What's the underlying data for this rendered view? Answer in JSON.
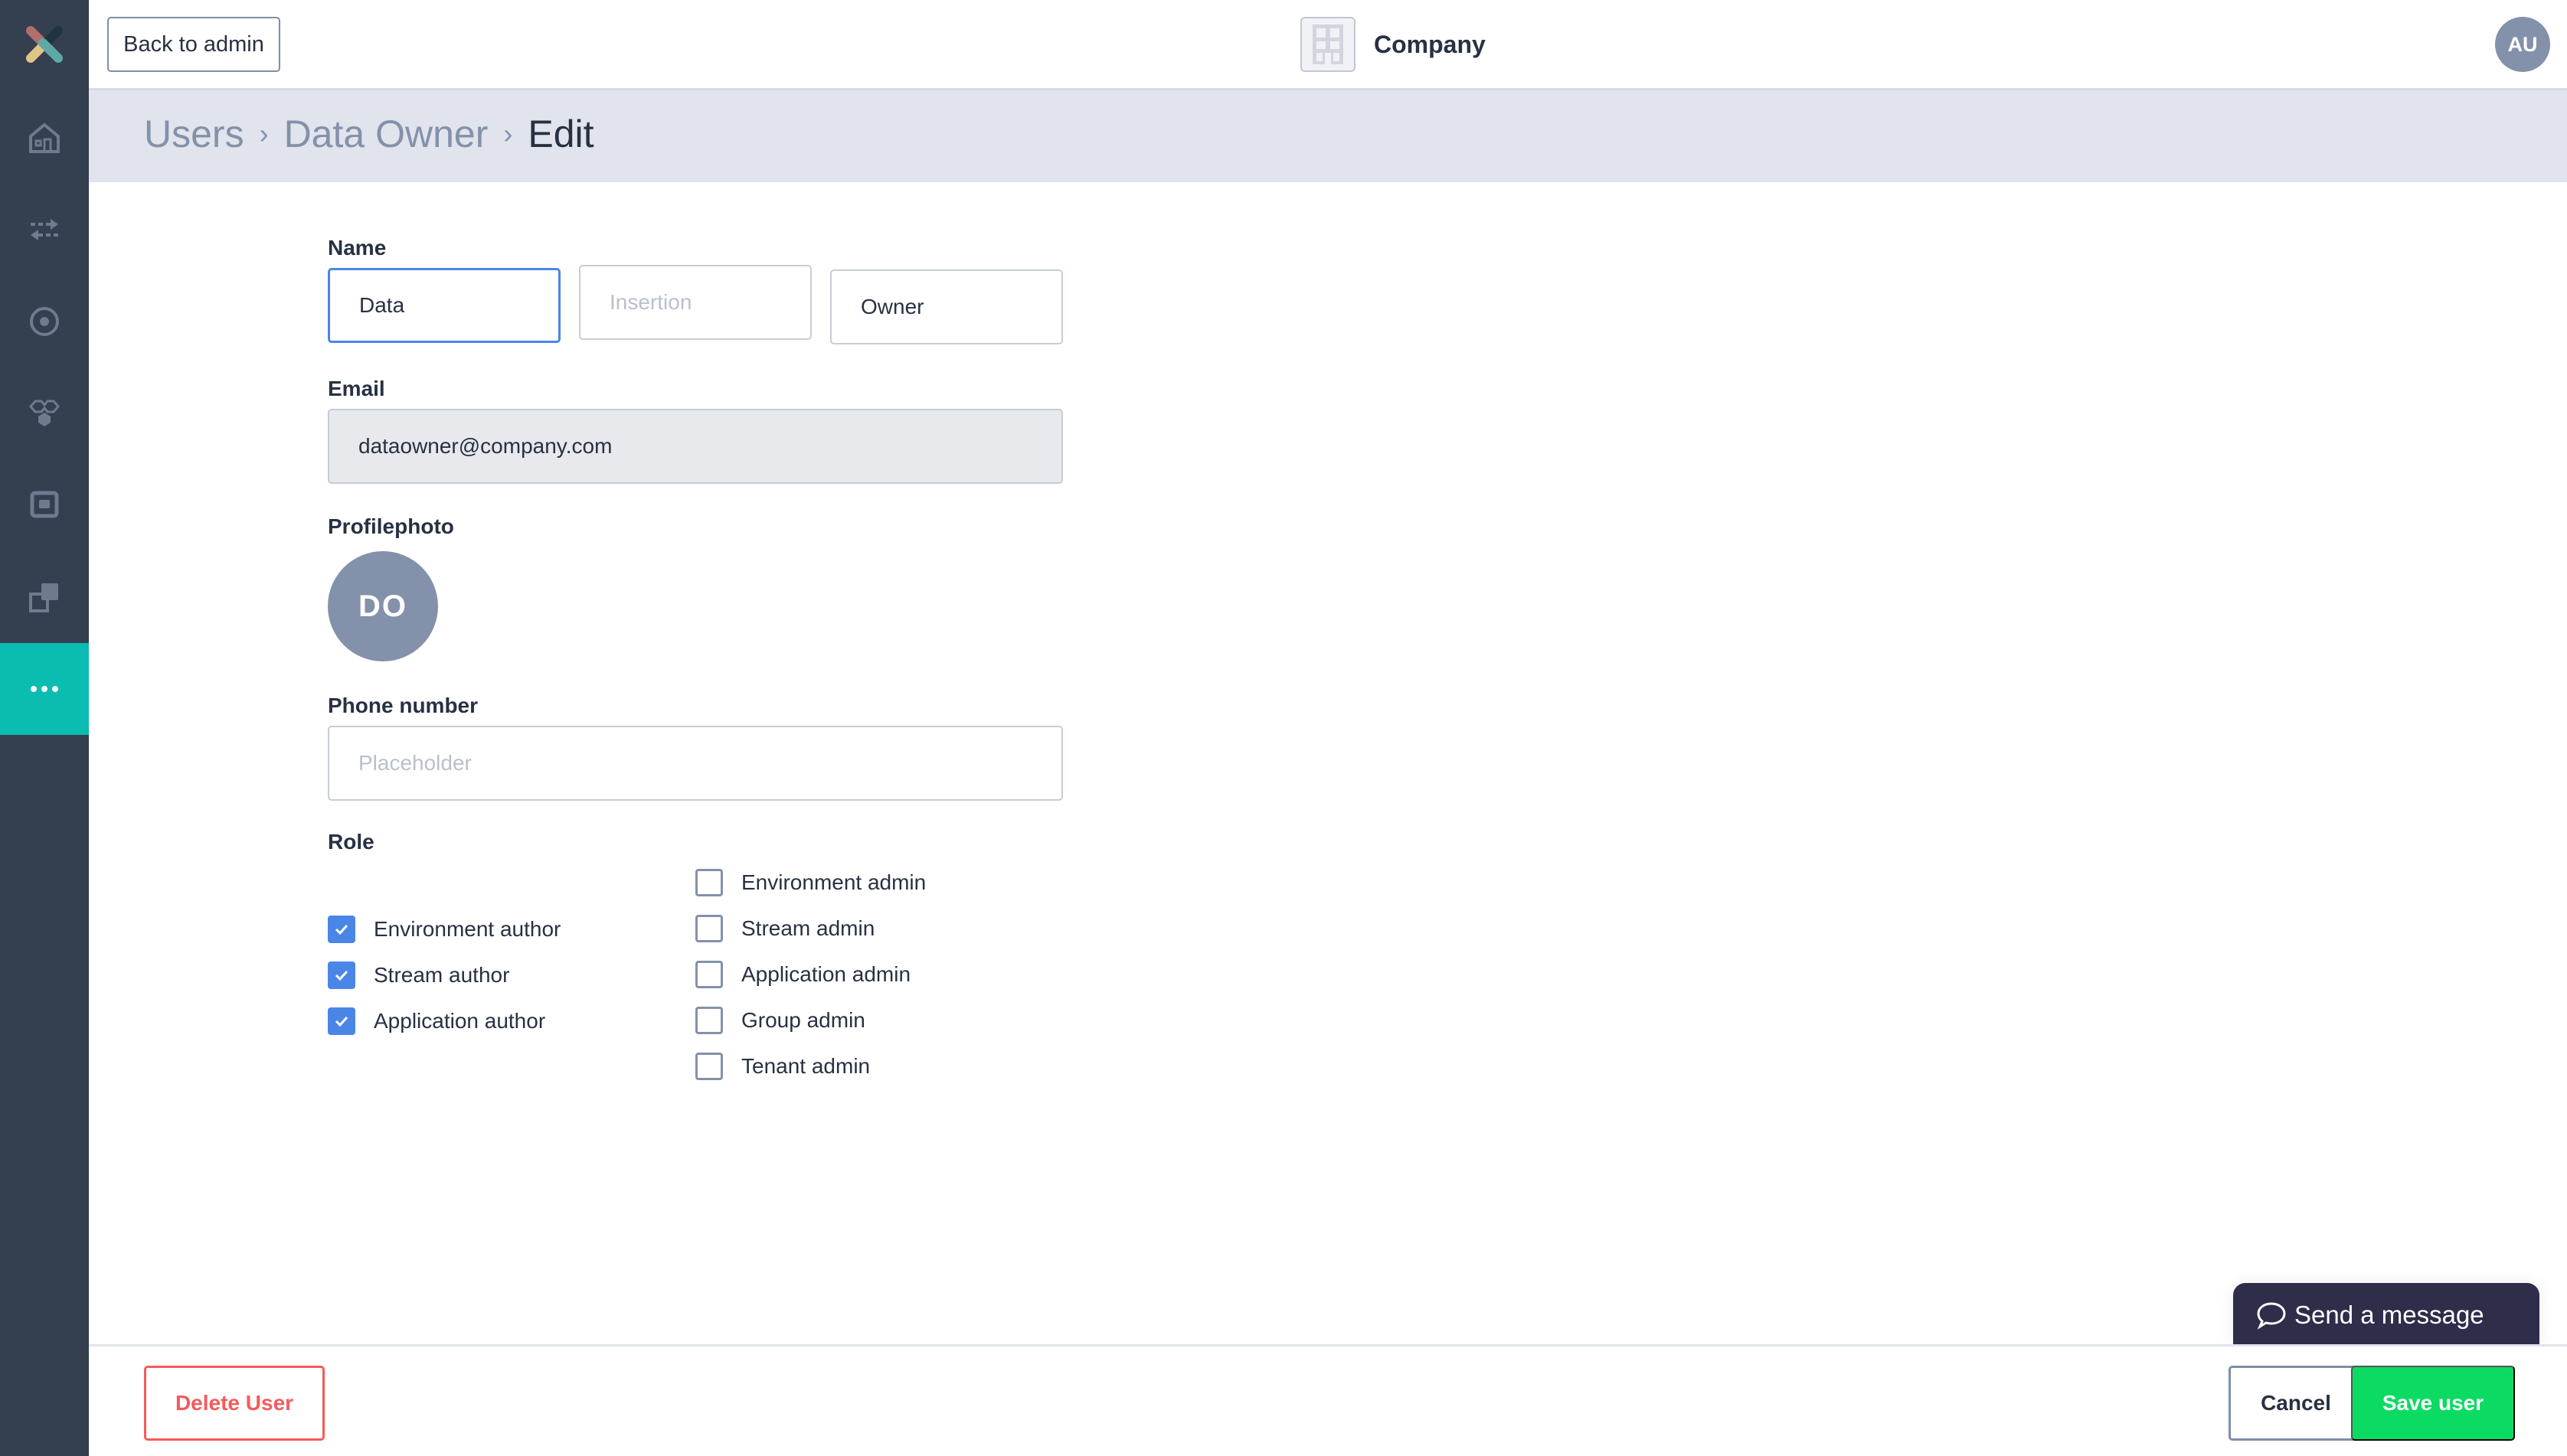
{
  "topbar": {
    "back_label": "Back to admin",
    "company_name": "Company",
    "user_initials": "AU"
  },
  "sidebar": {
    "items": [
      {
        "icon": "home-icon"
      },
      {
        "icon": "transfer-arrows-icon"
      },
      {
        "icon": "target-icon"
      },
      {
        "icon": "hexagon-group-icon"
      },
      {
        "icon": "square-frame-icon"
      },
      {
        "icon": "overlapping-squares-icon"
      },
      {
        "icon": "more-dots-icon",
        "active": true
      }
    ],
    "active_color": "#0bbcb0"
  },
  "breadcrumb": {
    "items": [
      "Users",
      "Data Owner",
      "Edit"
    ],
    "separator": "›"
  },
  "form": {
    "name_label": "Name",
    "first_name": "Data",
    "middle_name_placeholder": "Insertion",
    "last_name": "Owner",
    "email_label": "Email",
    "email_value": "dataowner@company.com",
    "photo_label": "Profilephoto",
    "photo_initials": "DO",
    "phone_label": "Phone number",
    "phone_placeholder": "Placeholder",
    "role_label": "Role",
    "roles_left": [
      {
        "label": "Environment author",
        "checked": true
      },
      {
        "label": "Stream author",
        "checked": true
      },
      {
        "label": "Application author",
        "checked": true
      }
    ],
    "roles_right": [
      {
        "label": "Environment admin",
        "checked": false
      },
      {
        "label": "Stream admin",
        "checked": false
      },
      {
        "label": "Application admin",
        "checked": false
      },
      {
        "label": "Group admin",
        "checked": false
      },
      {
        "label": "Tenant admin",
        "checked": false
      }
    ]
  },
  "footer": {
    "delete_label": "Delete User",
    "cancel_label": "Cancel",
    "save_label": "Save user"
  },
  "chat": {
    "label": "Send a message"
  },
  "colors": {
    "primary": "#4a86e8",
    "danger": "#f65a5b",
    "success": "#0bdb62",
    "sidebar": "#343f50"
  }
}
